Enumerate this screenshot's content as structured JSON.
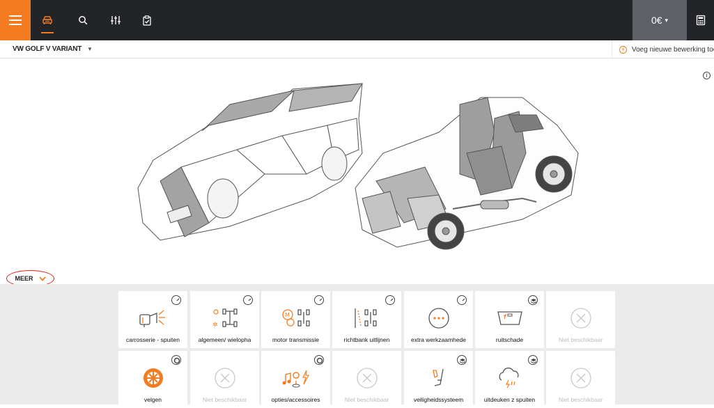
{
  "header": {
    "price": "0€",
    "colors": {
      "accent": "#f47c20",
      "topbar": "#222428",
      "price_bg": "#5d6066"
    },
    "icons": [
      "hamburger-menu-icon",
      "car-icon",
      "search-icon",
      "filter-sliders-icon",
      "clipboard-check-icon",
      "calculator-icon"
    ]
  },
  "vehicle": {
    "model": "VW GOLF V VARIANT",
    "add_operation": "Voeg nieuwe bewerking toe"
  },
  "more": {
    "label": "MEER"
  },
  "tiles": [
    {
      "label": "carrosserie - spuiten",
      "icon": "spray-gun-icon",
      "badge": "pressure-gauge-icon",
      "available": true
    },
    {
      "label": "algemeen/ wielopha",
      "icon": "wheel-alignment-icon",
      "badge": "pressure-gauge-icon",
      "available": true
    },
    {
      "label": "motor transmissie",
      "icon": "engine-transmission-icon",
      "badge": "pressure-gauge-icon",
      "available": true
    },
    {
      "label": "richtbank uitlijnen",
      "icon": "chassis-alignment-icon",
      "badge": "pressure-gauge-icon",
      "available": true
    },
    {
      "label": "extra werkzaamhede",
      "icon": "more-dots-icon",
      "badge": "pressure-gauge-icon",
      "available": true
    },
    {
      "label": "ruitschade",
      "icon": "windshield-icon",
      "badge": "layers-icon",
      "available": true
    },
    {
      "label": "Niet beschikbaar",
      "icon": "unavailable-x-icon",
      "available": false
    },
    {
      "label": "velgen",
      "icon": "rim-icon",
      "badge": "wheel-badge-icon",
      "available": true
    },
    {
      "label": "Niet beschikbaar",
      "icon": "unavailable-x-icon",
      "available": false
    },
    {
      "label": "opties/accessoires",
      "icon": "music-pin-bolt-icon",
      "badge": "wheel-badge-icon",
      "available": true
    },
    {
      "label": "Niet beschikbaar",
      "icon": "unavailable-x-icon",
      "available": false
    },
    {
      "label": "veiligheidssysteem",
      "icon": "seat-icon",
      "badge": "layers-icon",
      "available": true
    },
    {
      "label": "uitdeuken z spuiten",
      "icon": "hail-cloud-icon",
      "badge": "layers-icon",
      "available": true
    },
    {
      "label": "Niet beschikbaar",
      "icon": "unavailable-x-icon",
      "available": false
    }
  ]
}
